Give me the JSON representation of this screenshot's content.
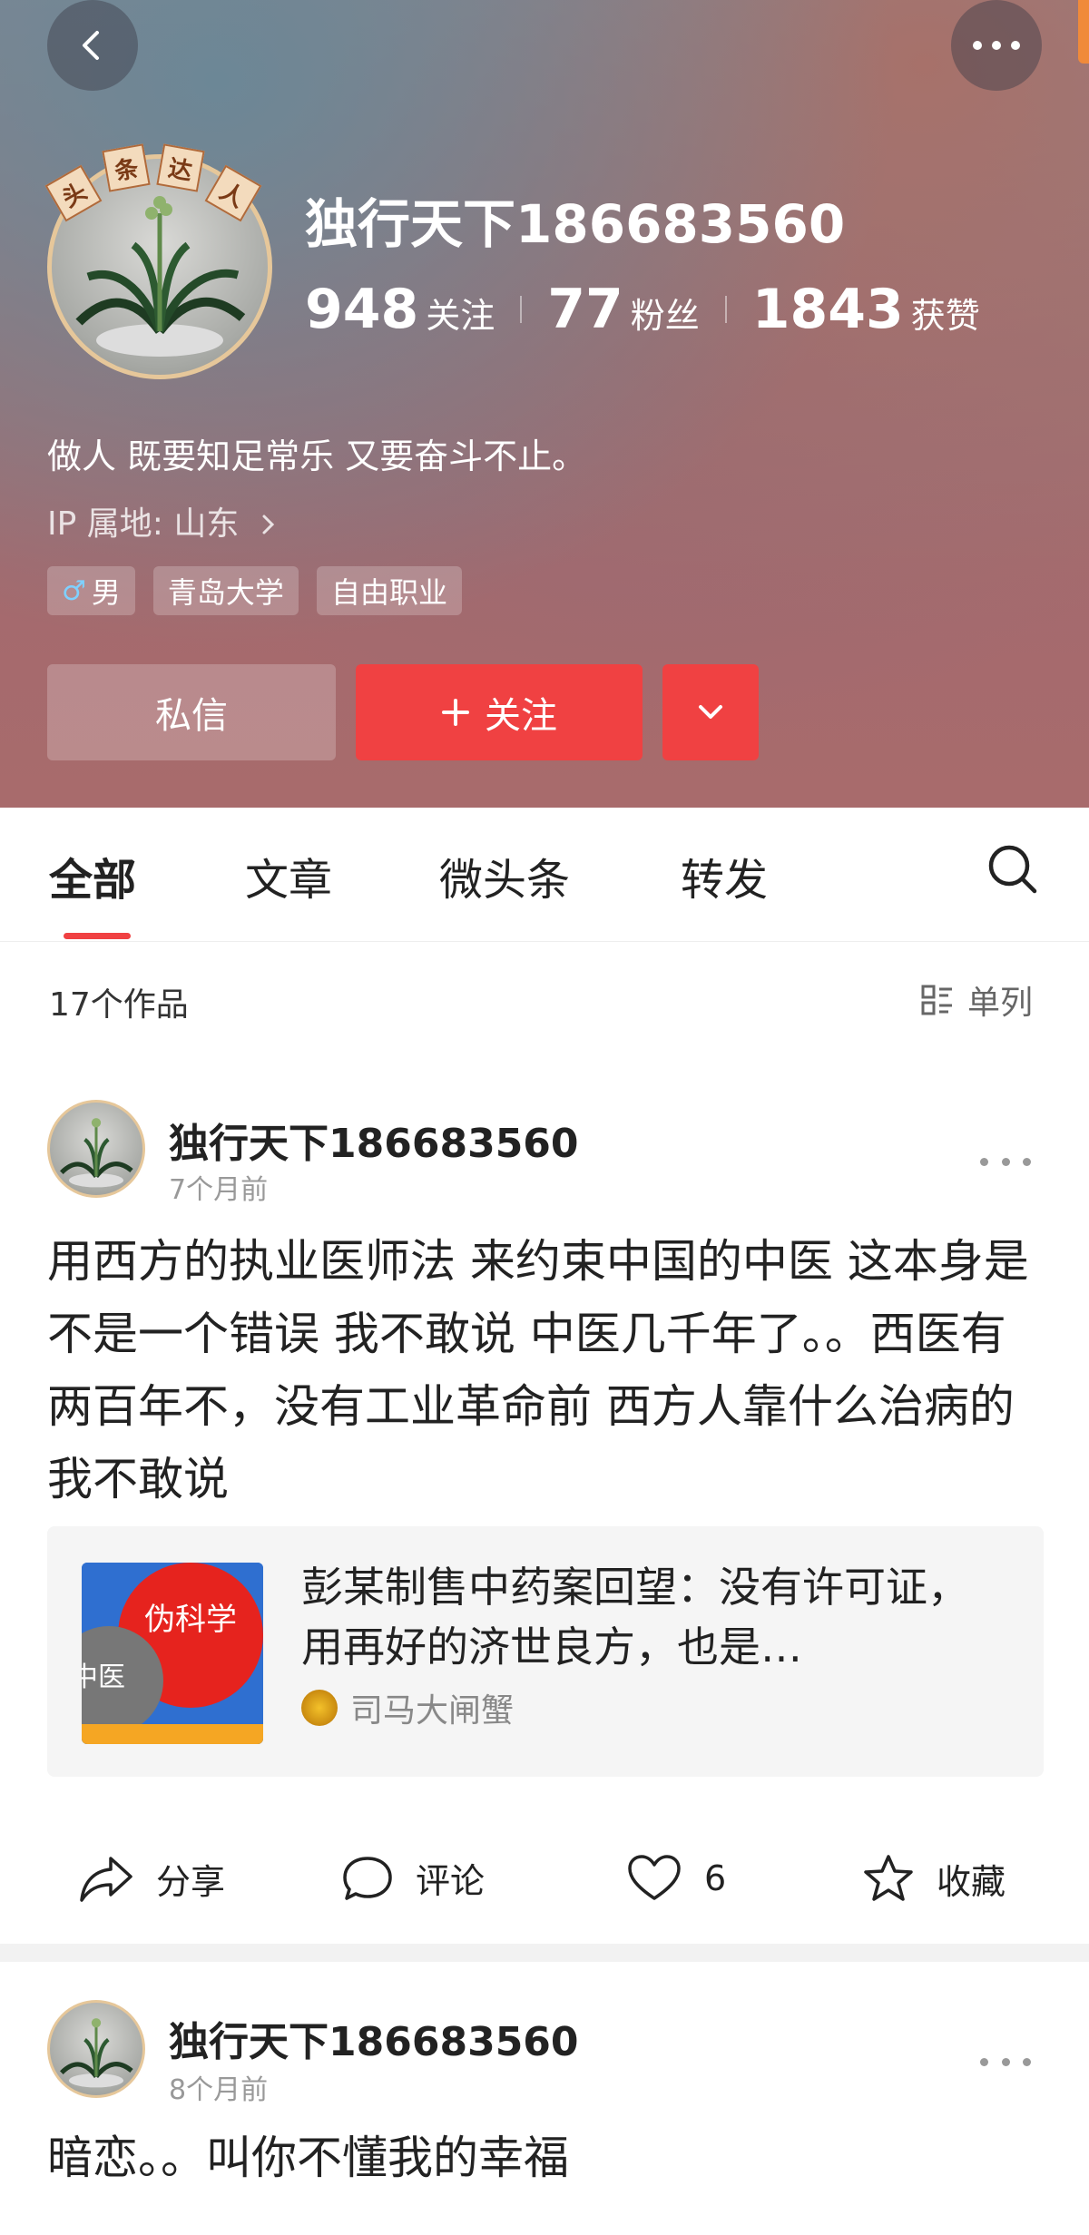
{
  "header": {
    "username": "独行天下186683560",
    "badge_chars": [
      "头",
      "条",
      "达",
      "人"
    ],
    "stats": {
      "following_count": "948",
      "following_label": "关注",
      "fans_count": "77",
      "fans_label": "粉丝",
      "likes_count": "1843",
      "likes_label": "获赞"
    },
    "bio": "做人 既要知足常乐 又要奋斗不止。",
    "ip_location": "IP 属地: 山东",
    "tags": [
      {
        "icon": "male-icon",
        "label": "男"
      },
      {
        "label": "青岛大学"
      },
      {
        "label": "自由职业"
      }
    ],
    "message_button": "私信",
    "follow_button": "关注"
  },
  "tabs": {
    "all": "全部",
    "articles": "文章",
    "micro": "微头条",
    "reposts": "转发"
  },
  "works": {
    "count": "17个作品",
    "view_mode": "单列"
  },
  "posts": [
    {
      "author": "独行天下186683560",
      "time": "7个月前",
      "text": "用西方的执业医师法 来约束中国的中医 这本身是不是一个错误 我不敢说 中医几千年了。。西医有两百年不，没有工业革命前 西方人靠什么治病的 我不敢说",
      "card": {
        "title": "彭某制售中药案回望：没有许可证，用再好的济世良方，也是…",
        "thumb_text_1": "伪科学",
        "thumb_text_2": "中医",
        "source": "司马大闸蟹"
      },
      "actions": {
        "share": "分享",
        "comment": "评论",
        "like_count": "6",
        "favorite": "收藏"
      }
    },
    {
      "author": "独行天下186683560",
      "time": "8个月前",
      "text": "暗恋。。叫你不懂我的幸福"
    }
  ],
  "colors": {
    "accent": "#f04142",
    "badge_frame": "#e6c79a"
  }
}
